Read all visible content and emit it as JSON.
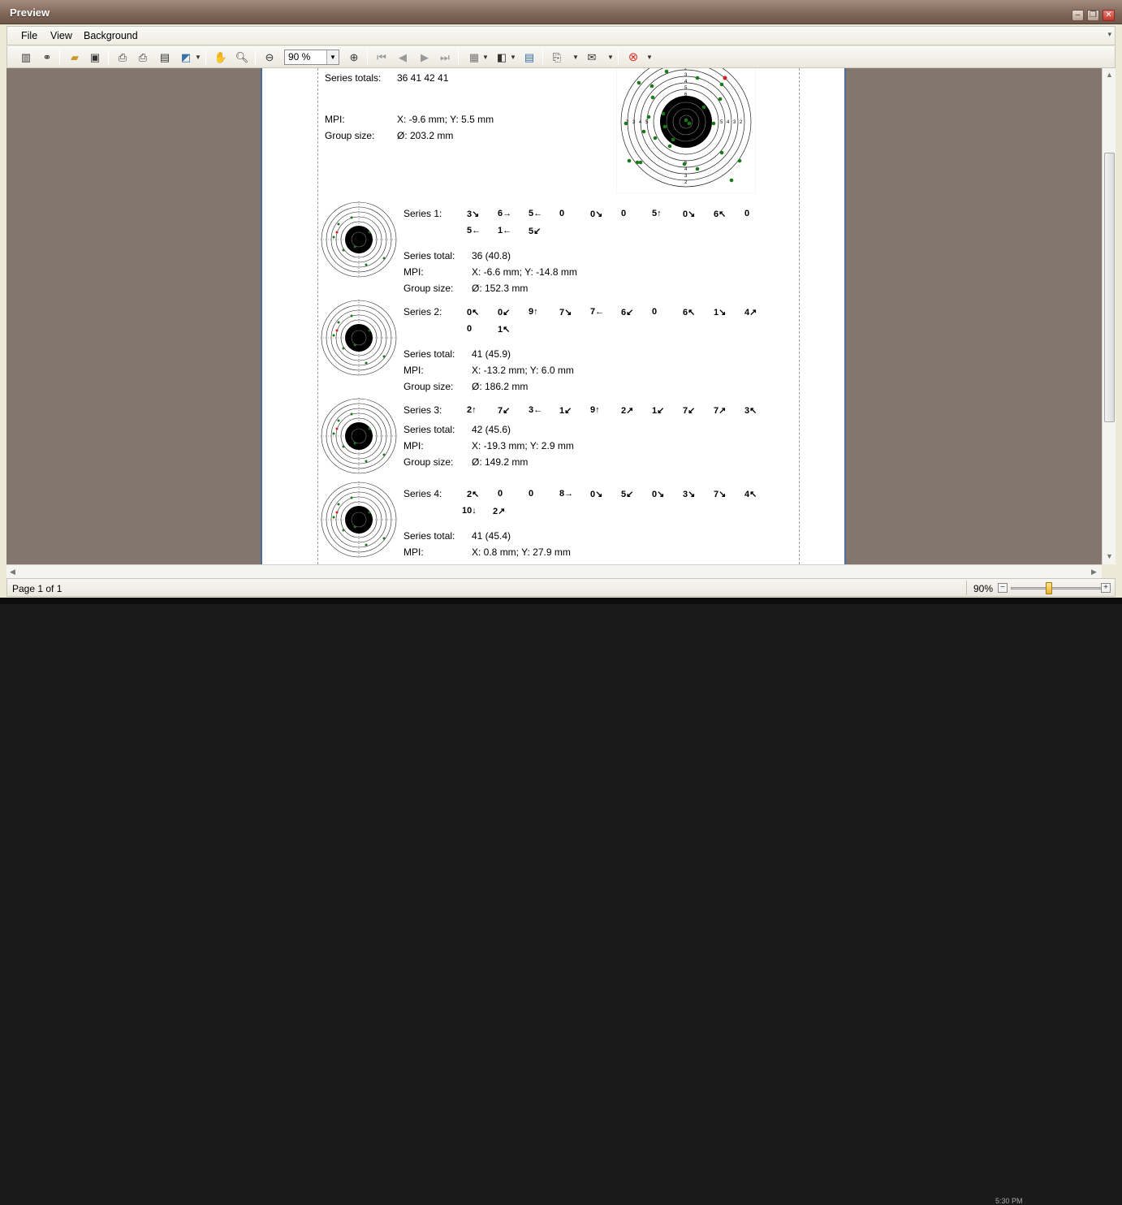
{
  "window": {
    "title": "Preview"
  },
  "menu": {
    "file": "File",
    "view": "View",
    "background": "Background"
  },
  "toolbar": {
    "zoom_value": "90 %"
  },
  "report": {
    "totals_label": "Series totals:",
    "totals_value": "36 41 42 41",
    "mpi_label": "MPI:",
    "mpi_value": "X: -9.6 mm; Y: 5.5 mm",
    "group_label": "Group size:",
    "group_value": "Ø: 203.2 mm",
    "series_total_label": "Series total:",
    "big_target_rings": [
      "1",
      "2",
      "3",
      "4",
      "5",
      "6",
      "7",
      "8",
      "9"
    ]
  },
  "series": [
    {
      "label": "Series 1:",
      "shots_row1": [
        "3↘",
        "6→",
        "5←",
        "0",
        "0↘",
        "0",
        "5↑",
        "0↘",
        "6↖",
        "0"
      ],
      "shots_row2": [
        "5←",
        "1←",
        "5↙"
      ],
      "total": "36 (40.8)",
      "mpi": "X: -6.6 mm; Y: -14.8 mm",
      "group": "Ø: 152.3 mm"
    },
    {
      "label": "Series 2:",
      "shots_row1": [
        "0↖",
        "0↙",
        "9↑",
        "7↘",
        "7←",
        "6↙",
        "0",
        "6↖",
        "1↘",
        "4↗"
      ],
      "shots_row2": [
        "0",
        "1↖"
      ],
      "total": "41 (45.9)",
      "mpi": "X: -13.2 mm; Y: 6.0 mm",
      "group": "Ø: 186.2 mm"
    },
    {
      "label": "Series 3:",
      "shots_row1": [
        "2↑",
        "7↙",
        "3←",
        "1↙",
        "9↑",
        "2↗",
        "1↙",
        "7↙",
        "7↗",
        "3↖"
      ],
      "shots_row2": [],
      "total": "42 (45.6)",
      "mpi": "X: -19.3 mm; Y: 2.9 mm",
      "group": "Ø: 149.2 mm"
    },
    {
      "label": "Series 4:",
      "shots_row1": [
        "2↖",
        "0",
        "0",
        "8→",
        "0↘",
        "5↙",
        "0↘",
        "3↘",
        "7↘",
        "4↖"
      ],
      "shots_row2": [
        "10↓",
        "2↗"
      ],
      "total": "41 (45.4)",
      "mpi": "X: 0.8 mm; Y: 27.9 mm",
      "group": ""
    }
  ],
  "status": {
    "page": "Page 1 of 1",
    "zoom": "90%"
  },
  "clock": {
    "line": "5:30 PM"
  }
}
